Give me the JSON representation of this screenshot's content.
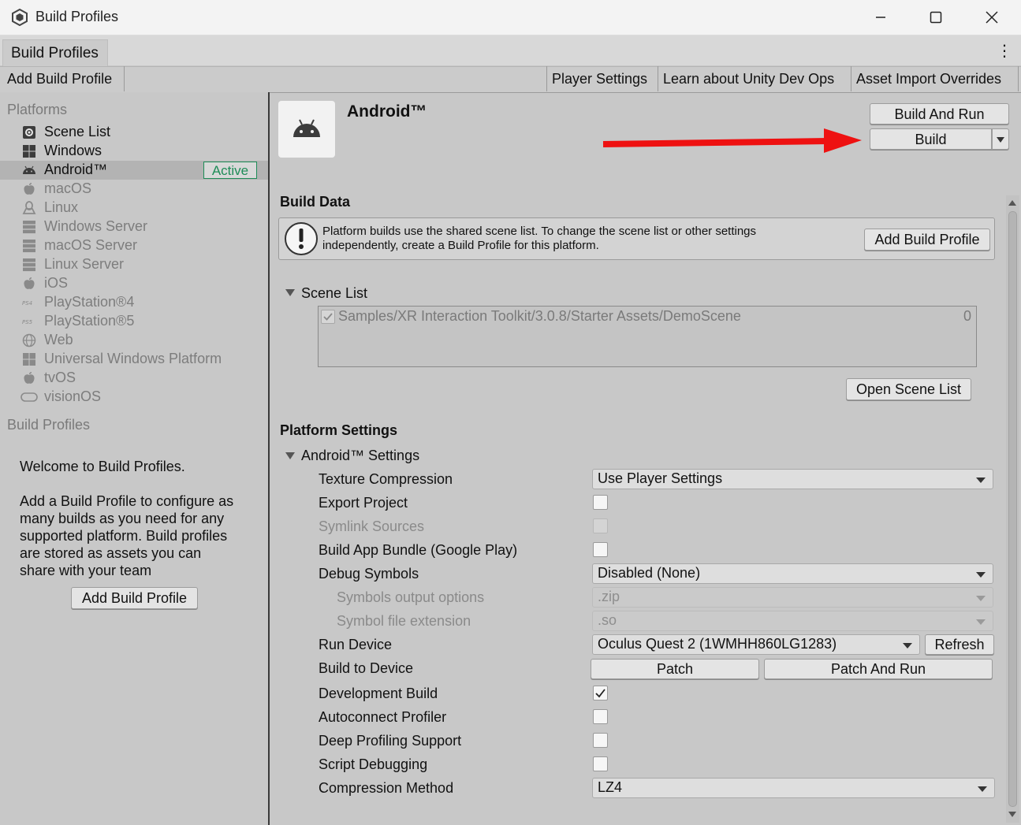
{
  "window": {
    "title": "Build Profiles"
  },
  "tabs": [
    {
      "label": "Build Profiles"
    }
  ],
  "toolbar": {
    "add_build_profile": "Add Build Profile",
    "player_settings": "Player Settings",
    "learn_dev_ops": "Learn about Unity Dev Ops",
    "asset_import_overrides": "Asset Import Overrides"
  },
  "sidebar": {
    "platforms_label": "Platforms",
    "platforms": [
      {
        "label": "Scene List",
        "icon": "scene-list-icon",
        "state": "normal"
      },
      {
        "label": "Windows",
        "icon": "windows-icon",
        "state": "normal"
      },
      {
        "label": "Android™",
        "icon": "android-icon",
        "state": "selected"
      },
      {
        "label": "macOS",
        "icon": "apple-icon",
        "state": "disabled"
      },
      {
        "label": "Linux",
        "icon": "linux-icon",
        "state": "disabled"
      },
      {
        "label": "Windows Server",
        "icon": "server-icon",
        "state": "disabled"
      },
      {
        "label": "macOS Server",
        "icon": "server-icon",
        "state": "disabled"
      },
      {
        "label": "Linux Server",
        "icon": "server-icon",
        "state": "disabled"
      },
      {
        "label": "iOS",
        "icon": "apple-icon",
        "state": "disabled"
      },
      {
        "label": "PlayStation®4",
        "icon": "ps4-icon",
        "state": "disabled"
      },
      {
        "label": "PlayStation®5",
        "icon": "ps5-icon",
        "state": "disabled"
      },
      {
        "label": "Web",
        "icon": "globe-icon",
        "state": "disabled"
      },
      {
        "label": "Universal Windows Platform",
        "icon": "windows-icon",
        "state": "disabled"
      },
      {
        "label": "tvOS",
        "icon": "apple-icon",
        "state": "disabled"
      },
      {
        "label": "visionOS",
        "icon": "visionos-icon",
        "state": "disabled"
      }
    ],
    "active_badge": "Active",
    "active_badge_color": "#1e8c57",
    "build_profiles_label": "Build Profiles",
    "welcome": "Welcome to Build Profiles.",
    "description_lines": [
      "Add a Build Profile to configure as",
      "many builds as you need for any",
      "supported platform. Build profiles",
      "are stored as assets you can",
      "share with your team"
    ],
    "add_button": "Add Build Profile"
  },
  "main": {
    "platform_title": "Android™",
    "build_and_run": "Build And Run",
    "build": "Build",
    "annotation_arrow_color": "#ee1111",
    "build_data": {
      "header": "Build Data",
      "help_text": "Platform builds use the shared scene list. To change the scene list or other settings independently, create a Build Profile for this platform.",
      "add_button": "Add Build Profile"
    },
    "scene_list": {
      "label": "Scene List",
      "scenes": [
        {
          "path": "Samples/XR Interaction Toolkit/3.0.8/Starter Assets/DemoScene",
          "index": "0",
          "checked": true
        }
      ],
      "open_button": "Open Scene List"
    },
    "platform_settings": {
      "header": "Platform Settings",
      "section": "Android™ Settings",
      "texture_compression": {
        "label": "Texture Compression",
        "value": "Use Player Settings"
      },
      "export_project": {
        "label": "Export Project",
        "checked": false
      },
      "symlink_sources": {
        "label": "Symlink Sources",
        "checked": false
      },
      "build_app_bundle": {
        "label": "Build App Bundle (Google Play)",
        "checked": false
      },
      "debug_symbols": {
        "label": "Debug Symbols",
        "value": "Disabled (None)"
      },
      "symbols_output": {
        "label": "Symbols output options",
        "value": ".zip"
      },
      "symbol_ext": {
        "label": "Symbol file extension",
        "value": ".so"
      },
      "run_device": {
        "label": "Run Device",
        "value": "Oculus Quest 2 (1WMHH860LG1283)",
        "refresh": "Refresh"
      },
      "build_to_device": {
        "label": "Build to Device",
        "patch": "Patch",
        "patch_and_run": "Patch And Run"
      },
      "development_build": {
        "label": "Development Build",
        "checked": true
      },
      "autoconnect_profiler": {
        "label": "Autoconnect Profiler",
        "checked": false
      },
      "deep_profiling": {
        "label": "Deep Profiling Support",
        "checked": false
      },
      "script_debugging": {
        "label": "Script Debugging",
        "checked": false
      },
      "compression_method": {
        "label": "Compression Method",
        "value": "LZ4"
      }
    }
  }
}
